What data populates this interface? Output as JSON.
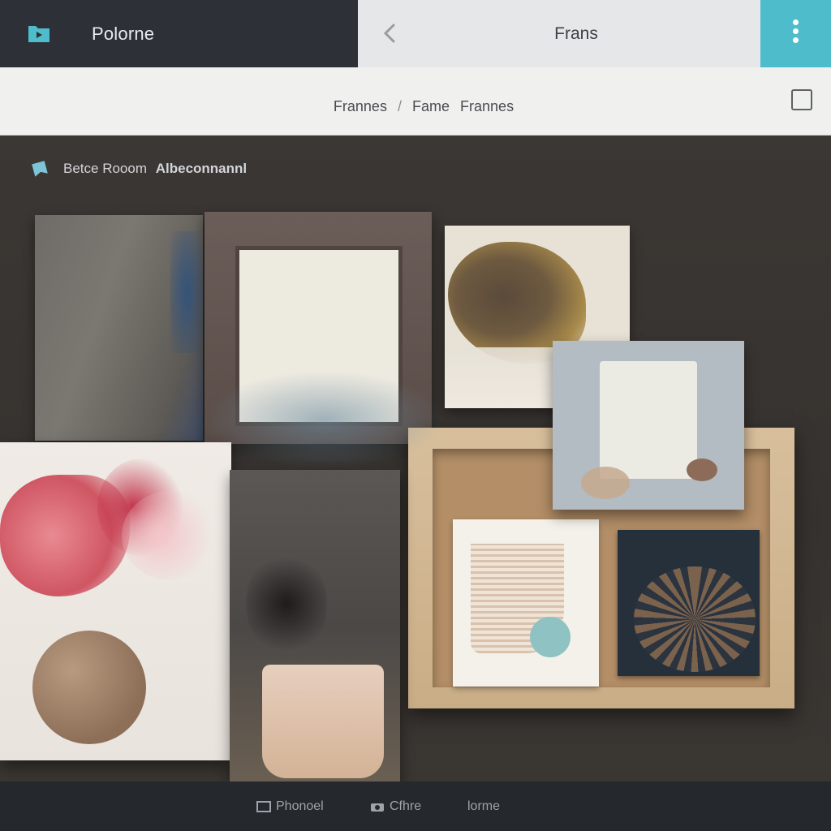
{
  "header": {
    "app_title": "Polorne",
    "center_title": "Frans",
    "accent_color": "#4ebccb",
    "icons": [
      "folder-icon",
      "back-arrow-icon",
      "kebab-menu-icon"
    ]
  },
  "breadcrumb": {
    "items": [
      "Frannes",
      "Fame",
      "Frannes"
    ],
    "separator": "/"
  },
  "section": {
    "label": "Betce Rooom",
    "label_bold": "Albeconnannl",
    "icon": "bookmark-icon"
  },
  "gallery": {
    "frames": [
      "fabric-panel",
      "brown-frame",
      "abstract-painting",
      "blue-panel",
      "wood-shadow-box",
      "flower-photo",
      "gauze-fabric"
    ]
  },
  "bottom_nav": {
    "items": [
      {
        "label": "Phonoel",
        "icon": "image-icon"
      },
      {
        "label": "Cfhre",
        "icon": "camera-icon"
      },
      {
        "label": "lorme",
        "icon": ""
      }
    ]
  }
}
